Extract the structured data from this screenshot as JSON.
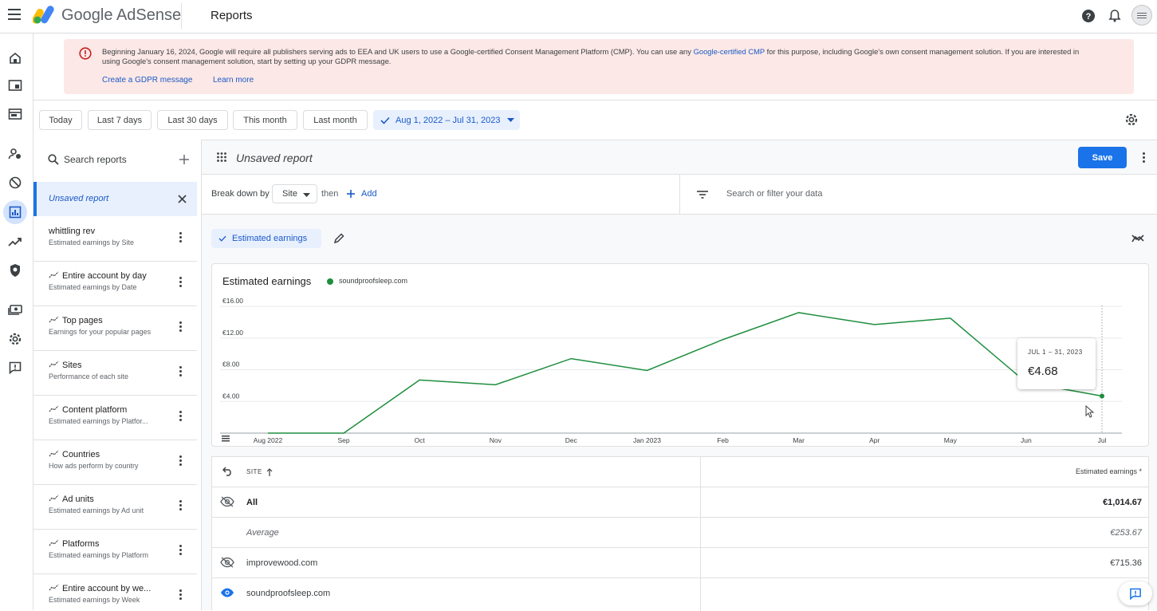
{
  "header": {
    "brand": "Google AdSense",
    "page_title": "Reports"
  },
  "banner": {
    "text_pre": "Beginning January 16, 2024, Google will require all publishers serving ads to EEA and UK users to use a Google-certified Consent Management Platform (CMP). You can use any ",
    "text_link": "Google-certified CMP",
    "text_post": " for this purpose, including Google's own consent management solution. If you are interested in using Google's consent management solution, start by setting up your GDPR message.",
    "create_link": "Create a GDPR message",
    "learn_link": "Learn more",
    "color": "#fce8e6"
  },
  "date_chips": [
    "Today",
    "Last 7 days",
    "Last 30 days",
    "This month",
    "Last month"
  ],
  "date_range": "Aug 1, 2022 – Jul 31, 2023",
  "sidebar": {
    "search_placeholder": "Search reports",
    "active_report": "Unsaved report",
    "reports": [
      {
        "name": "whittling rev",
        "desc": "Estimated earnings by Site",
        "autogen": false
      },
      {
        "name": "Entire account by day",
        "desc": "Estimated earnings by Date",
        "autogen": true
      },
      {
        "name": "Top pages",
        "desc": "Earnings for your popular pages",
        "autogen": true
      },
      {
        "name": "Sites",
        "desc": "Performance of each site",
        "autogen": true
      },
      {
        "name": "Content platform",
        "desc": "Estimated earnings by Platfor...",
        "autogen": true
      },
      {
        "name": "Countries",
        "desc": "How ads perform by country",
        "autogen": true
      },
      {
        "name": "Ad units",
        "desc": "Estimated earnings by Ad unit",
        "autogen": true
      },
      {
        "name": "Platforms",
        "desc": "Estimated earnings by Platform",
        "autogen": true
      },
      {
        "name": "Entire account by we...",
        "desc": "Estimated earnings by Week",
        "autogen": true
      }
    ]
  },
  "report": {
    "title": "Unsaved report",
    "save_label": "Save",
    "breakdown_label": "Break down by",
    "breakdown_value": "Site",
    "then_label": "then",
    "add_label": "Add",
    "filter_placeholder": "Search or filter your data",
    "metric_chip": "Estimated earnings"
  },
  "chart_data": {
    "type": "line",
    "title": "Estimated earnings",
    "series": [
      {
        "name": "soundproofsleep.com",
        "color": "#1e8e3e",
        "values": [
          0,
          0,
          6.7,
          6.1,
          9.4,
          7.9,
          11.8,
          15.2,
          13.7,
          14.5,
          6.4,
          4.68
        ]
      }
    ],
    "categories": [
      "Aug 2022",
      "Sep",
      "Oct",
      "Nov",
      "Dec",
      "Jan 2023",
      "Feb",
      "Mar",
      "Apr",
      "May",
      "Jun",
      "Jul"
    ],
    "y_ticks": [
      "€4.00",
      "€8.00",
      "€12.00",
      "€16.00"
    ],
    "ylim": [
      0,
      16
    ],
    "grid": true,
    "tooltip": {
      "label": "JUL 1 – 31, 2023",
      "value": "€4.68"
    }
  },
  "table": {
    "col_site": "SITE",
    "col_earnings": "Estimated earnings *",
    "rows": [
      {
        "site": "All",
        "earnings": "€1,014.67"
      },
      {
        "site": "Average",
        "earnings": "€253.67"
      },
      {
        "site": "improvewood.com",
        "earnings": "€715.36"
      },
      {
        "site": "soundproofsleep.com",
        "earnings": ""
      }
    ]
  }
}
